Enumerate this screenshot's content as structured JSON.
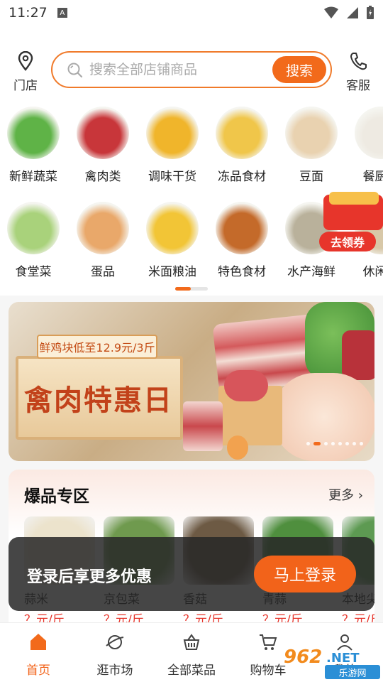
{
  "status_bar": {
    "time": "11:27",
    "a_badge": "A"
  },
  "header": {
    "store_label": "门店",
    "search_placeholder": "搜索全部店铺商品",
    "search_button": "搜索",
    "service_label": "客服"
  },
  "categories": [
    {
      "label": "新鲜蔬菜",
      "color": "#5fb347"
    },
    {
      "label": "禽肉类",
      "color": "#c8363a"
    },
    {
      "label": "调味干货",
      "color": "#f0b52b"
    },
    {
      "label": "冻品食材",
      "color": "#f0c64a"
    },
    {
      "label": "豆面",
      "color": "#e9d2b0"
    },
    {
      "label": "餐厨用",
      "color": "#eeeae2"
    },
    {
      "label": "食堂菜",
      "color": "#a9d27b"
    },
    {
      "label": "蛋品",
      "color": "#e9a86a"
    },
    {
      "label": "米面粮油",
      "color": "#f2c536"
    },
    {
      "label": "特色食材",
      "color": "#c46a2a"
    },
    {
      "label": "水产海鲜",
      "color": "#b9b19b"
    },
    {
      "label": "休闲零",
      "color": "#d8c8a8"
    }
  ],
  "coupon": {
    "label": "去领券"
  },
  "banner": {
    "promo": "鲜鸡块低至12.9元/3斤",
    "headline": "禽肉特惠日"
  },
  "hot_section": {
    "title": "爆品专区",
    "more": "更多",
    "products": [
      {
        "name": "蒜米",
        "price": "？元/斤",
        "color": "#ece3cc"
      },
      {
        "name": "京包菜",
        "price": "？元/斤",
        "color": "#6f9a4e"
      },
      {
        "name": "香菇",
        "price": "？元/斤",
        "color": "#6d5a44"
      },
      {
        "name": "青蒜",
        "price": "？元/斤",
        "color": "#4f8f3e"
      },
      {
        "name": "本地尖",
        "price": "？元/斤",
        "color": "#5d9a52"
      }
    ]
  },
  "login_prompt": {
    "message": "登录后享更多优惠",
    "button": "马上登录"
  },
  "tabs": [
    {
      "label": "首页",
      "active": true
    },
    {
      "label": "逛市场",
      "active": false
    },
    {
      "label": "全部菜品",
      "active": false
    },
    {
      "label": "购物车",
      "active": false
    },
    {
      "label": "我的",
      "active": false
    }
  ],
  "watermark": {
    "number": "962",
    "domain": ".NET",
    "site": "乐游网"
  },
  "colors": {
    "accent": "#f26a1b",
    "price_red": "#e7352b"
  }
}
